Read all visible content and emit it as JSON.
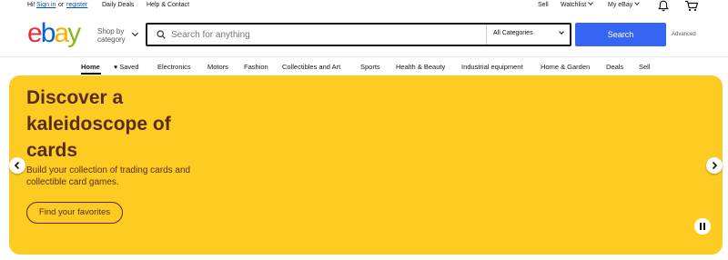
{
  "topbar": {
    "greeting": "Hi!",
    "sign_in": "Sign in",
    "or": "or",
    "register": "register",
    "daily_deals": "Daily Deals",
    "help_contact": "Help & Contact",
    "sell": "Sell",
    "watchlist": "Watchlist",
    "my_ebay": "My eBay"
  },
  "header": {
    "logo_letters": [
      "e",
      "b",
      "a",
      "y"
    ],
    "logo_colors": [
      "#e53238",
      "#0064d2",
      "#f5af02",
      "#86b817"
    ],
    "shop_by_line1": "Shop by",
    "shop_by_line2": "category",
    "search_placeholder": "Search for anything",
    "category_selected": "All Categories",
    "search_button": "Search",
    "advanced": "Advanced"
  },
  "nav": {
    "items": [
      "Home",
      "Saved",
      "Electronics",
      "Motors",
      "Fashion",
      "Collectibles and Art",
      "Sports",
      "Health & Beauty",
      "Industrial equipment",
      "Home & Garden",
      "Deals",
      "Sell"
    ]
  },
  "banner": {
    "headline": "Discover a kaleidoscope of cards",
    "subtext": "Build your collection of trading cards and collectible card games.",
    "cta": "Find your favorites",
    "background_color": "#fccc23",
    "text_color": "#5a2b18"
  },
  "colors": {
    "accent": "#3665f3",
    "link": "#0654ba"
  }
}
